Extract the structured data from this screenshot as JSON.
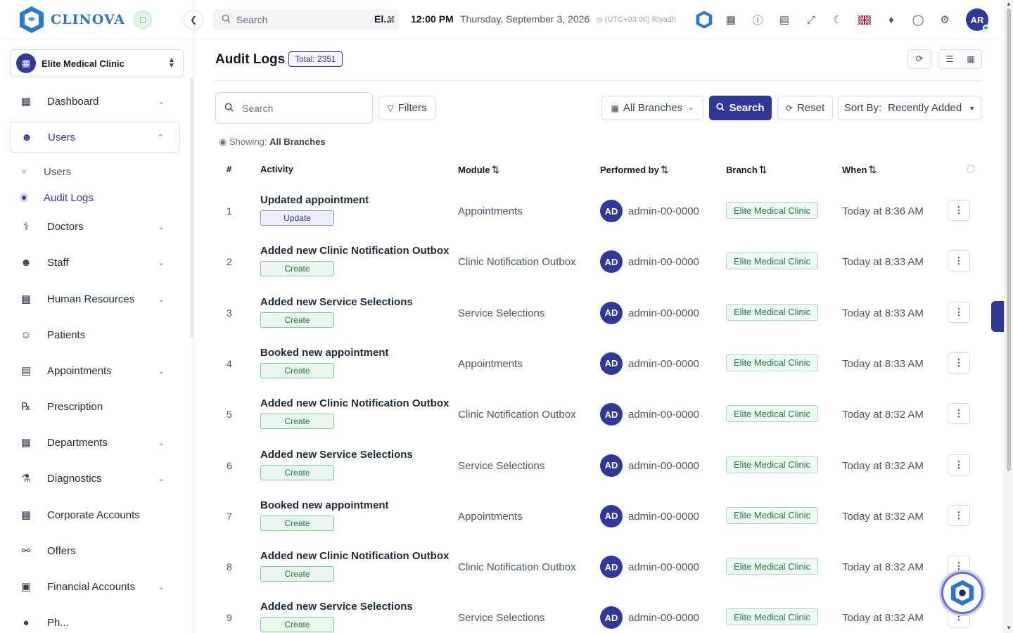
{
  "brand": {
    "name": "CLINOVA",
    "colors": {
      "primary": "#30399a",
      "logo": "#2b77c9",
      "success": "#1e7b3d"
    }
  },
  "clinic_selector": {
    "value": "Elite Medical Clinic"
  },
  "sidebar": {
    "items": [
      {
        "label": "Dashboard",
        "icon": "dashboard-icon",
        "expandable": true
      },
      {
        "label": "Users",
        "icon": "users-icon",
        "expandable": true,
        "active": true
      },
      {
        "label": "Doctors",
        "icon": "stethoscope-icon",
        "expandable": true
      },
      {
        "label": "Staff",
        "icon": "staff-icon",
        "expandable": true
      },
      {
        "label": "Human Resources",
        "icon": "building-icon",
        "expandable": true
      },
      {
        "label": "Patients",
        "icon": "patient-icon",
        "expandable": false
      },
      {
        "label": "Appointments",
        "icon": "calendar-icon",
        "expandable": true
      },
      {
        "label": "Prescription",
        "icon": "rx-icon",
        "expandable": false
      },
      {
        "label": "Departments",
        "icon": "department-icon",
        "expandable": true
      },
      {
        "label": "Diagnostics",
        "icon": "microscope-icon",
        "expandable": true
      },
      {
        "label": "Corporate Accounts",
        "icon": "corporate-icon",
        "expandable": false
      },
      {
        "label": "Offers",
        "icon": "offer-icon",
        "expandable": false
      },
      {
        "label": "Financial Accounts",
        "icon": "bank-icon",
        "expandable": true
      },
      {
        "label": "Ph...",
        "icon": "pharmacy-icon",
        "expandable": false
      }
    ],
    "users_sub": [
      {
        "label": "Users",
        "active": false
      },
      {
        "label": "Audit Logs",
        "active": true
      }
    ]
  },
  "topbar": {
    "search_placeholder": "Search",
    "search_shortcut": "⌘",
    "search_trailing": "El...",
    "time": "12:00 PM",
    "date": "Thursday, September 3, 2026",
    "timezone": "(UTC+03:00) Riyadh",
    "icons": [
      "apps-icon",
      "help-icon",
      "clipboard-icon",
      "fullscreen-icon",
      "moon-icon",
      "uk-flag-icon",
      "bell-icon",
      "chat-icon",
      "gear-icon"
    ],
    "avatar_initials": "AR"
  },
  "page": {
    "title": "Audit Logs",
    "total_badge": "Total: 2351"
  },
  "filters": {
    "search_placeholder": "Search",
    "filters_label": "Filters",
    "branch_select": "All Branches",
    "search_button": "Search",
    "reset_button": "Reset",
    "sort_prefix": "Sort By:",
    "sort_value": "Recently Added",
    "showing_prefix": "Showing:",
    "showing_value": "All Branches"
  },
  "table": {
    "headers": {
      "num": "#",
      "activity": "Activity",
      "module": "Module",
      "performed_by": "Performed by",
      "branch": "Branch",
      "when": "When"
    },
    "rows": [
      {
        "num": "1",
        "activity": "Updated appointment",
        "tag": "Update",
        "module": "Appointments",
        "initials": "AD",
        "user": "admin-00-0000",
        "branch": "Elite Medical Clinic",
        "when": "Today at 8:36 AM"
      },
      {
        "num": "2",
        "activity": "Added new Clinic Notification Outbox",
        "tag": "Create",
        "module": "Clinic Notification Outbox",
        "initials": "AD",
        "user": "admin-00-0000",
        "branch": "Elite Medical Clinic",
        "when": "Today at 8:33 AM"
      },
      {
        "num": "3",
        "activity": "Added new Service Selections",
        "tag": "Create",
        "module": "Service Selections",
        "initials": "AD",
        "user": "admin-00-0000",
        "branch": "Elite Medical Clinic",
        "when": "Today at 8:33 AM"
      },
      {
        "num": "4",
        "activity": "Booked new appointment",
        "tag": "Create",
        "module": "Appointments",
        "initials": "AD",
        "user": "admin-00-0000",
        "branch": "Elite Medical Clinic",
        "when": "Today at 8:33 AM"
      },
      {
        "num": "5",
        "activity": "Added new Clinic Notification Outbox",
        "tag": "Create",
        "module": "Clinic Notification Outbox",
        "initials": "AD",
        "user": "admin-00-0000",
        "branch": "Elite Medical Clinic",
        "when": "Today at 8:32 AM"
      },
      {
        "num": "6",
        "activity": "Added new Service Selections",
        "tag": "Create",
        "module": "Service Selections",
        "initials": "AD",
        "user": "admin-00-0000",
        "branch": "Elite Medical Clinic",
        "when": "Today at 8:32 AM"
      },
      {
        "num": "7",
        "activity": "Booked new appointment",
        "tag": "Create",
        "module": "Appointments",
        "initials": "AD",
        "user": "admin-00-0000",
        "branch": "Elite Medical Clinic",
        "when": "Today at 8:32 AM"
      },
      {
        "num": "8",
        "activity": "Added new Clinic Notification Outbox",
        "tag": "Create",
        "module": "Clinic Notification Outbox",
        "initials": "AD",
        "user": "admin-00-0000",
        "branch": "Elite Medical Clinic",
        "when": "Today at 8:32 AM"
      },
      {
        "num": "9",
        "activity": "Added new Service Selections",
        "tag": "Create",
        "module": "Service Selections",
        "initials": "AD",
        "user": "admin-00-0000",
        "branch": "Elite Medical Clinic",
        "when": "Today at 8:32 AM"
      }
    ]
  }
}
